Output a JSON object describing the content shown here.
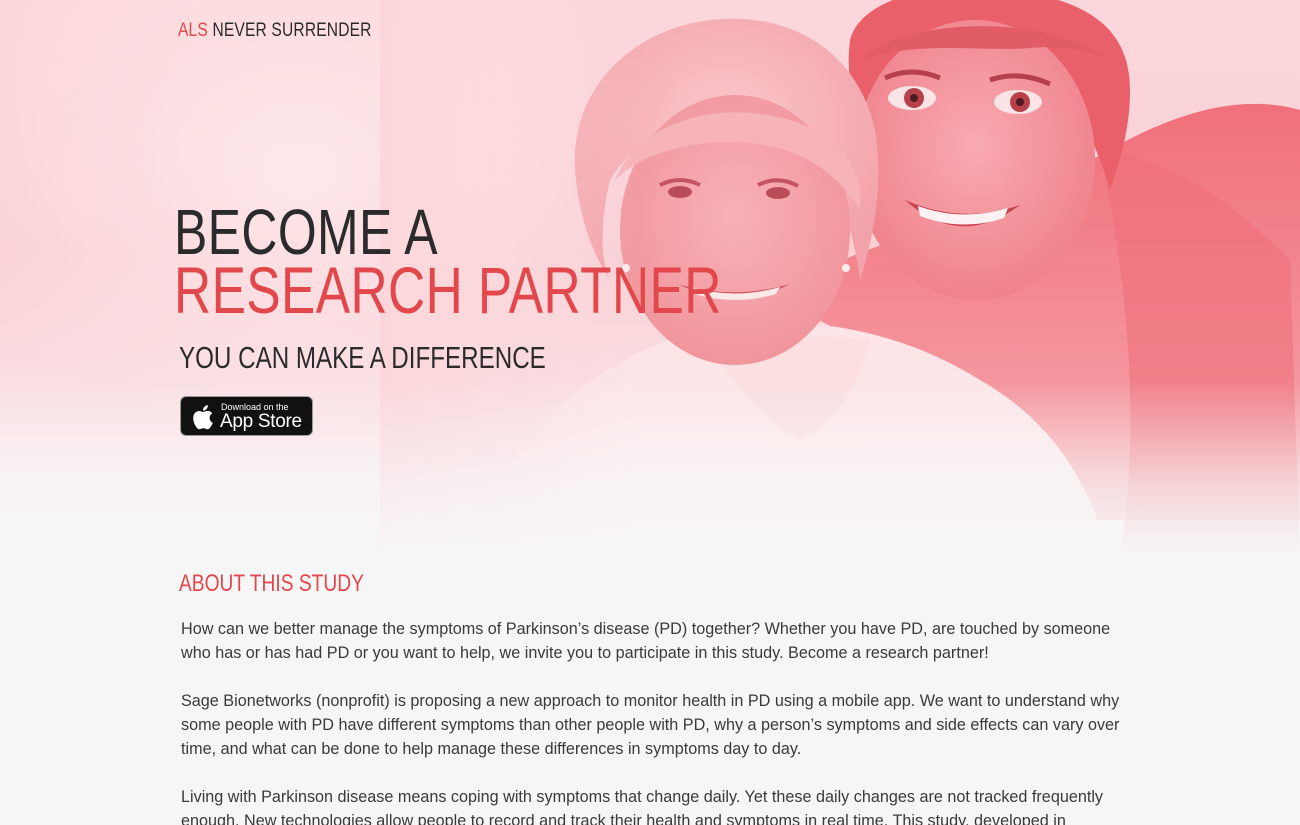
{
  "brand": {
    "accent": "ALS",
    "rest": "NEVER SURRENDER"
  },
  "hero": {
    "headline_line1": "BECOME A",
    "headline_line2": "RESEARCH PARTNER",
    "tagline": "YOU CAN MAKE A DIFFERENCE",
    "appstore": {
      "small": "Download on the",
      "big": "App Store",
      "icon": "apple-icon"
    }
  },
  "about": {
    "heading": "ABOUT THIS STUDY",
    "paragraphs": [
      "How can we better manage the symptoms of Parkinson’s disease (PD) together? Whether you have PD, are touched by someone who has or has had PD or you want to help, we invite you to participate in this study. Become a research partner!",
      "Sage Bionetworks (nonprofit) is proposing a new approach to monitor health in PD using a mobile app. We want to understand why some people with PD have different symptoms than other people with PD, why a person’s symptoms and side effects can vary over time, and what can be done to help manage these differences in symptoms day to day.",
      "Living with Parkinson disease means coping with symptoms that change daily. Yet these daily changes are not tracked frequently enough. New technologies allow people to record and track their health and symptoms in real time. This study, developed in"
    ]
  },
  "colors": {
    "accent": "#e2484b",
    "text_dark": "#2b2b2b",
    "body_text": "#3a3a3a",
    "background": "#f7f6f6",
    "hero_tint": "#f47d86"
  }
}
